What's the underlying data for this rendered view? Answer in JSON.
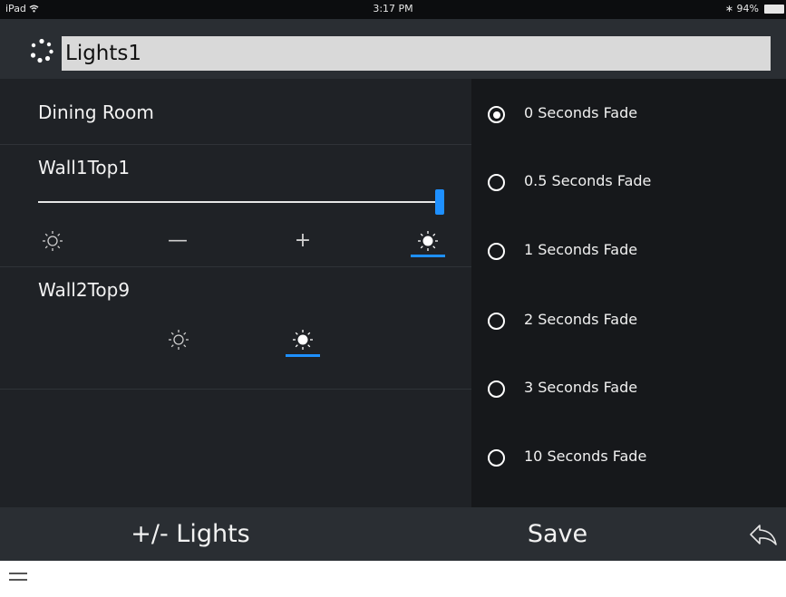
{
  "status_bar": {
    "device": "iPad",
    "time": "3:17 PM",
    "battery": "94%"
  },
  "header": {
    "title": "Lights1"
  },
  "left_list": {
    "room": "Dining Room",
    "wall1": {
      "label": "Wall1Top1",
      "level_fraction": 1.0
    },
    "wall2": {
      "label": "Wall2Top9"
    },
    "controls": {
      "minus": "—",
      "plus": "+"
    }
  },
  "fade_options": [
    {
      "label": "0 Seconds Fade",
      "selected": true
    },
    {
      "label": "0.5 Seconds Fade",
      "selected": false
    },
    {
      "label": "1 Seconds Fade",
      "selected": false
    },
    {
      "label": "2 Seconds Fade",
      "selected": false
    },
    {
      "label": "3 Seconds Fade",
      "selected": false
    },
    {
      "label": "10 Seconds Fade",
      "selected": false
    }
  ],
  "toolbar": {
    "lights_label": "+/- Lights",
    "save_label": "Save"
  },
  "colors": {
    "accent": "#1e90ff",
    "background": "#1f2226",
    "panel": "#16181b"
  },
  "icons": {
    "wifi": "wifi-icon",
    "spinner": "loading-spinner-icon",
    "sun_off": "sun-outline-icon",
    "sun_on": "sun-filled-icon",
    "back": "back-arrow-icon",
    "menu": "hamburger-icon"
  }
}
